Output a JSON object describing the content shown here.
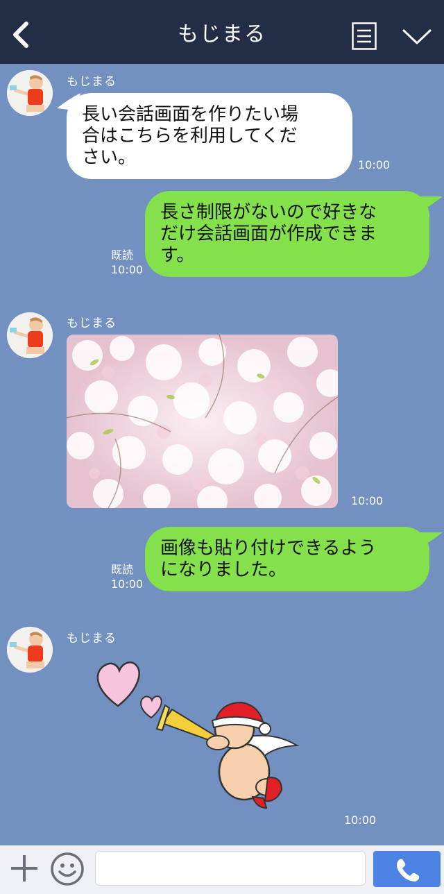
{
  "header": {
    "title": "もじまる",
    "back_icon": "chevron-left-icon",
    "menu_icon": "list-icon",
    "collapse_icon": "chevron-down-icon"
  },
  "colors": {
    "header_bg": "#232d45",
    "chat_bg": "#7290c0",
    "incoming_bubble": "#ffffff",
    "outgoing_bubble": "#85e14b",
    "call_button": "#4c82e1"
  },
  "messages": [
    {
      "direction": "incoming",
      "sender": "もじまる",
      "lines": [
        "長い会話画面を作りたい場",
        "合はこちらを利用してくだ",
        "さい。"
      ],
      "time": "10:00"
    },
    {
      "direction": "outgoing",
      "read": "既読",
      "lines": [
        "長さ制限がないので好きな",
        "だけ会話画面が作成できま",
        "す。"
      ],
      "time": "10:00"
    },
    {
      "direction": "incoming",
      "sender": "もじまる",
      "type": "image",
      "image": "cherry-blossom-photo",
      "time": "10:00"
    },
    {
      "direction": "outgoing",
      "read": "既読",
      "lines": [
        "画像も貼り付けできるよう",
        "になりました。"
      ],
      "time": "10:00"
    },
    {
      "direction": "incoming",
      "sender": "もじまる",
      "type": "sticker",
      "sticker": "cupid-santa-hat-trumpet-hearts",
      "time": "10:00"
    }
  ],
  "inputbar": {
    "plus_icon": "plus-icon",
    "emoji_icon": "smiley-icon",
    "input_value": "",
    "call_icon": "phone-icon"
  }
}
